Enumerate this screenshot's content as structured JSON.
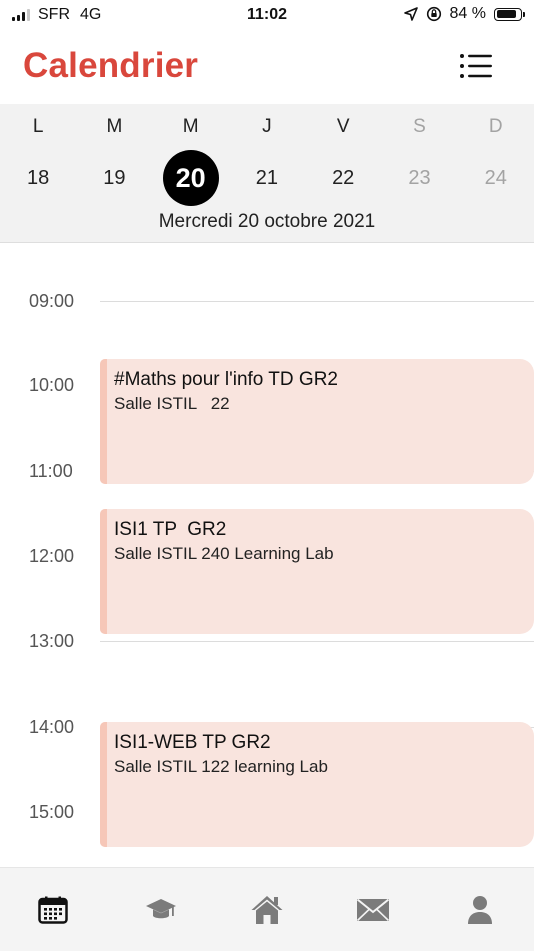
{
  "status_bar": {
    "carrier": "SFR",
    "network": "4G",
    "time": "11:02",
    "battery_text": "84 %",
    "battery_level": 0.84
  },
  "header": {
    "title": "Calendrier",
    "title_color": "#d9473c",
    "menu_icon": "list-menu-icon"
  },
  "week": {
    "days": [
      {
        "letter": "L",
        "number": "18",
        "weekend": false,
        "selected": false
      },
      {
        "letter": "M",
        "number": "19",
        "weekend": false,
        "selected": false
      },
      {
        "letter": "M",
        "number": "20",
        "weekend": false,
        "selected": true
      },
      {
        "letter": "J",
        "number": "21",
        "weekend": false,
        "selected": false
      },
      {
        "letter": "V",
        "number": "22",
        "weekend": false,
        "selected": false
      },
      {
        "letter": "S",
        "number": "23",
        "weekend": true,
        "selected": false
      },
      {
        "letter": "D",
        "number": "24",
        "weekend": true,
        "selected": false
      }
    ],
    "selected_date": "Mercredi 20 octobre 2021"
  },
  "timeline": {
    "hours": [
      "09:00",
      "10:00",
      "11:00",
      "12:00",
      "13:00",
      "14:00",
      "15:00"
    ],
    "events": [
      {
        "title": "#Maths pour l'info TD GR2",
        "room": "Salle ISTIL   22"
      },
      {
        "title": "ISI1 TP  GR2",
        "room": "Salle ISTIL 240 Learning Lab"
      },
      {
        "title": "ISI1-WEB TP GR2",
        "room": "Salle ISTIL 122 learning Lab"
      }
    ],
    "event_color": "#f9e4de",
    "event_accent": "#f6c7b8"
  },
  "tabbar": {
    "tabs": [
      {
        "icon": "calendar-icon",
        "active": true
      },
      {
        "icon": "graduation-cap-icon",
        "active": false
      },
      {
        "icon": "home-icon",
        "active": false
      },
      {
        "icon": "mail-icon",
        "active": false
      },
      {
        "icon": "user-icon",
        "active": false
      }
    ]
  }
}
